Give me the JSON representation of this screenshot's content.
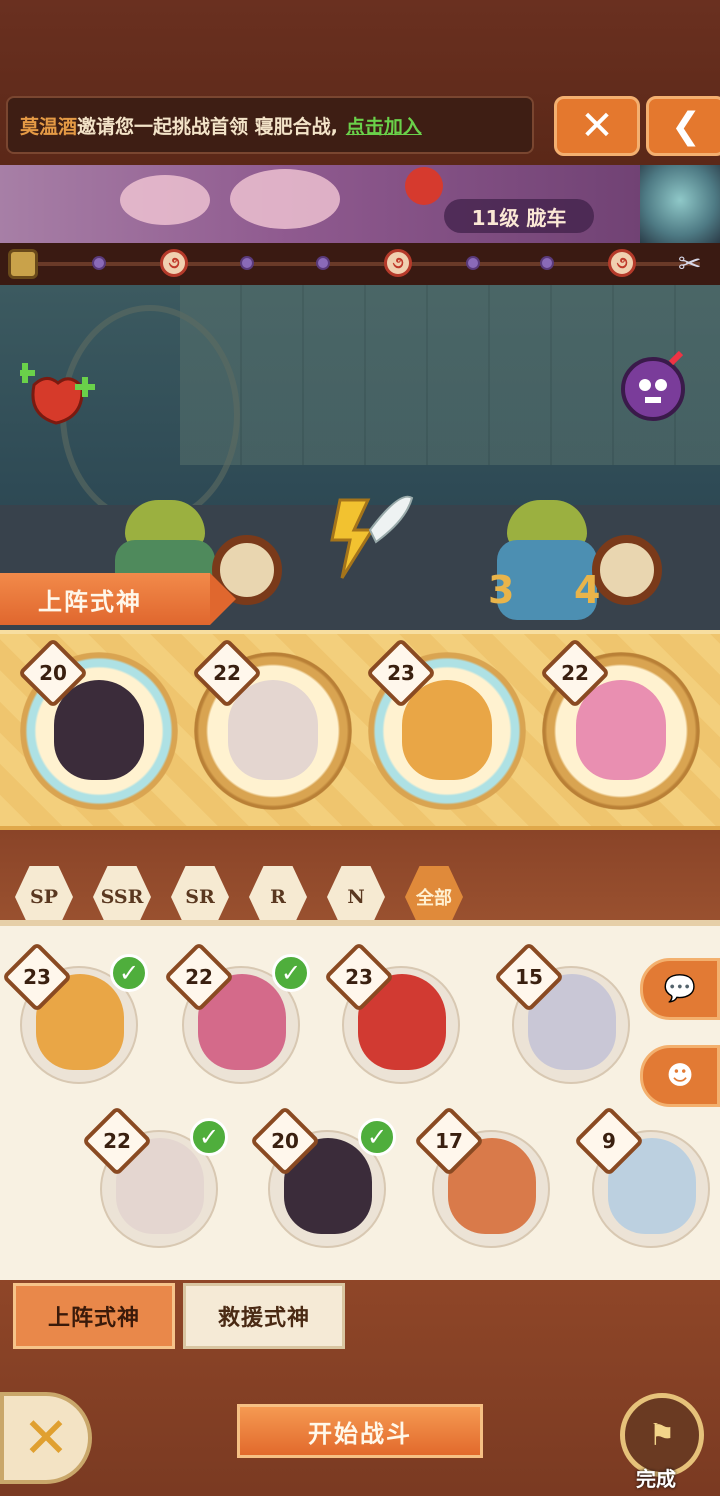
{
  "invite": {
    "inviter": "莫温酒",
    "message": "邀请您一起挑战首领 寝肥合战,",
    "join_link": "点击加入"
  },
  "top_buttons": {
    "close_icon": "close-icon",
    "back_icon": "back-arrow-icon"
  },
  "stage": {
    "label": "11级 胧车"
  },
  "progress_track": {
    "waypoints": [
      "dot",
      "swirl",
      "dot",
      "dot",
      "swirl",
      "dot",
      "dot",
      "swirl"
    ]
  },
  "scene": {
    "lineup_tab": "上阵式神",
    "digits": [
      "3",
      "4"
    ]
  },
  "lineup": [
    {
      "level": "20",
      "color": "#3b2c3a",
      "glow": true
    },
    {
      "level": "22",
      "color": "#e4d6d0",
      "glow": false
    },
    {
      "level": "23",
      "color": "#e9a646",
      "glow": true
    },
    {
      "level": "22",
      "color": "#e98fb1",
      "glow": false
    }
  ],
  "filters": [
    "SP",
    "SSR",
    "SR",
    "R",
    "N",
    "全部"
  ],
  "active_filter": "全部",
  "roster": [
    {
      "level": "23",
      "color": "#e9a646",
      "selected": true
    },
    {
      "level": "22",
      "color": "#d46a8a",
      "selected": true
    },
    {
      "level": "23",
      "color": "#d13a32",
      "selected": false
    },
    {
      "level": "15",
      "color": "#c9c7d6",
      "selected": false
    },
    {
      "level": "22",
      "color": "#e4d6d0",
      "selected": true
    },
    {
      "level": "20",
      "color": "#3b2c3a",
      "selected": true
    },
    {
      "level": "17",
      "color": "#d97a4a",
      "selected": false
    },
    {
      "level": "9",
      "color": "#bcd0e0",
      "selected": false
    }
  ],
  "side_buttons": [
    "chat-icon",
    "shikigami-icon"
  ],
  "bottom": {
    "tab_lineup": "上阵式神",
    "tab_rescue": "救援式神",
    "start_battle": "开始战斗",
    "done": "完成"
  }
}
